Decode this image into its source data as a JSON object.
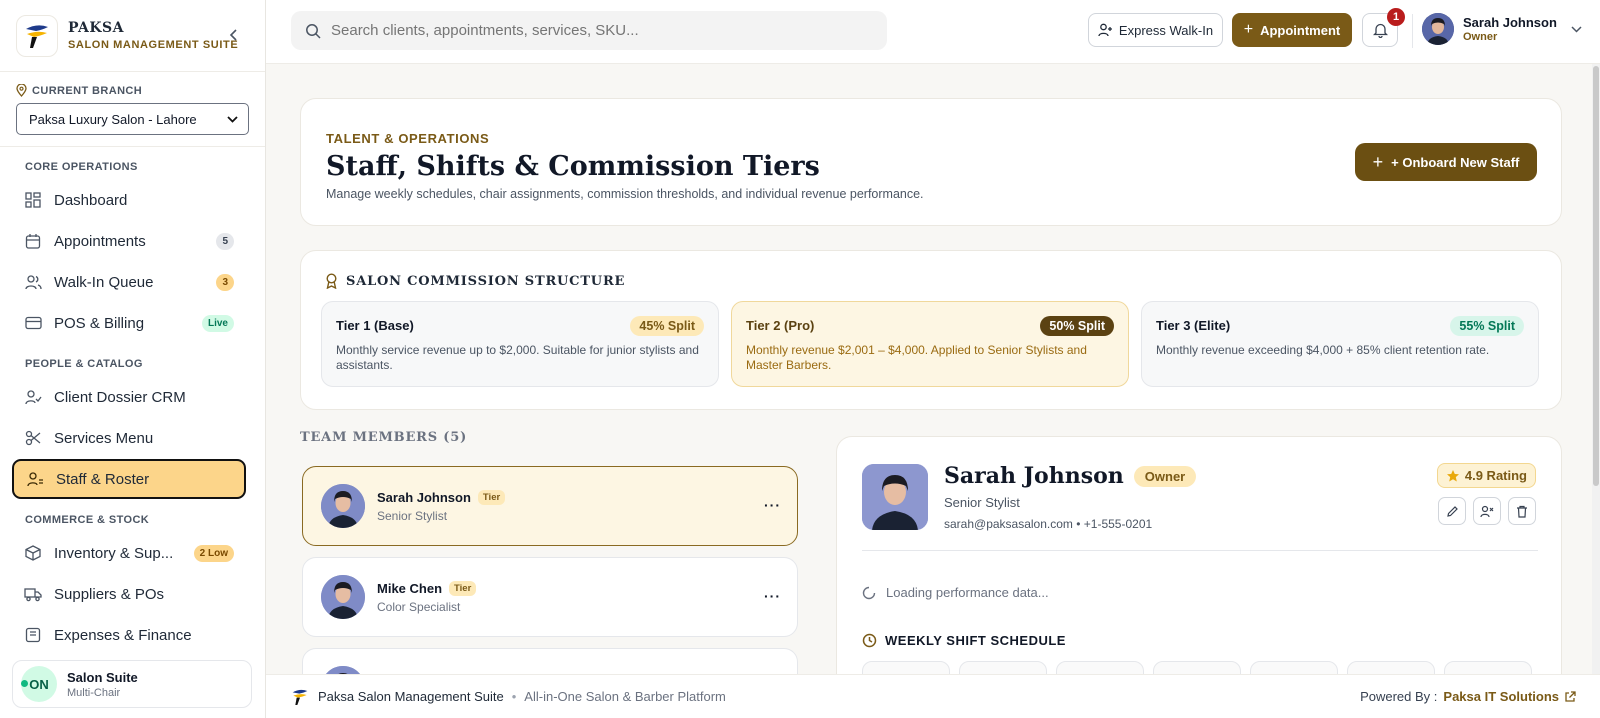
{
  "brand": {
    "name": "PAKSA",
    "subtitle": "SALON MANAGEMENT SUITE"
  },
  "branch": {
    "label": "CURRENT BRANCH",
    "selected": "Paksa Luxury Salon - Lahore"
  },
  "sidebar": {
    "sections": [
      {
        "title": "CORE OPERATIONS"
      },
      {
        "title": "PEOPLE & CATALOG"
      },
      {
        "title": "COMMERCE & STOCK"
      }
    ],
    "items": [
      {
        "label": "Dashboard",
        "icon": "grid-icon"
      },
      {
        "label": "Appointments",
        "icon": "calendar-icon",
        "badge": "5"
      },
      {
        "label": "Walk-In Queue",
        "icon": "users-icon",
        "badge": "3"
      },
      {
        "label": "POS & Billing",
        "icon": "credit-card-icon",
        "badge": "Live"
      },
      {
        "label": "Client Dossier CRM",
        "icon": "user-check-icon"
      },
      {
        "label": "Services Menu",
        "icon": "scissors-icon"
      },
      {
        "label": "Staff & Roster",
        "icon": "staff-icon"
      },
      {
        "label": "Inventory & Sup...",
        "icon": "box-icon",
        "badge": "2 Low"
      },
      {
        "label": "Suppliers & POs",
        "icon": "truck-icon"
      },
      {
        "label": "Expenses & Finance",
        "icon": "finance-icon"
      }
    ],
    "footer": {
      "status": "ON",
      "title": "Salon Suite",
      "subtitle": "Multi-Chair"
    }
  },
  "topbar": {
    "search_placeholder": "Search clients, appointments, services, SKU...",
    "walkin_label": "Express Walk-In",
    "appointment_label": "Appointment",
    "notifications_count": "1",
    "user": {
      "name": "Sarah Johnson",
      "role": "Owner"
    }
  },
  "header": {
    "eyebrow": "TALENT & OPERATIONS",
    "title": "Staff, Shifts & Commission Tiers",
    "description": "Manage weekly schedules, chair assignments, commission thresholds, and individual revenue performance.",
    "onboard_label": "+ Onboard New Staff"
  },
  "commission": {
    "title": "SALON COMMISSION STRUCTURE",
    "tiers": [
      {
        "name": "Tier 1 (Base)",
        "split": "45% Split",
        "description": "Monthly service revenue up to $2,000. Suitable for junior stylists and assistants."
      },
      {
        "name": "Tier 2 (Pro)",
        "split": "50% Split",
        "description": "Monthly revenue $2,001 – $4,000. Applied to Senior Stylists and Master Barbers."
      },
      {
        "name": "Tier 3 (Elite)",
        "split": "55% Split",
        "description": "Monthly revenue exceeding $4,000 + 85% client retention rate."
      }
    ]
  },
  "team": {
    "title": "TEAM MEMBERS (5)",
    "members": [
      {
        "name": "Sarah Johnson",
        "tier": "Tier",
        "role": "Senior Stylist"
      },
      {
        "name": "Mike Chen",
        "tier": "Tier",
        "role": "Color Specialist"
      }
    ]
  },
  "detail": {
    "name": "Sarah Johnson",
    "badge": "Owner",
    "role": "Senior Stylist",
    "contact": "sarah@paksasalon.com • +1-555-0201",
    "rating": "4.9 Rating",
    "loading": "Loading performance data...",
    "schedule_title": "WEEKLY SHIFT SCHEDULE"
  },
  "bottombar": {
    "name": "Paksa Salon Management Suite",
    "separator": "•",
    "tagline": "All-in-One Salon & Barber Platform",
    "powered_label": "Powered By :",
    "powered_link": "Paksa IT Solutions"
  },
  "colors": {
    "accent": "#7a5a17",
    "active_nav": "#fcd58a",
    "danger": "#b91c1c"
  }
}
